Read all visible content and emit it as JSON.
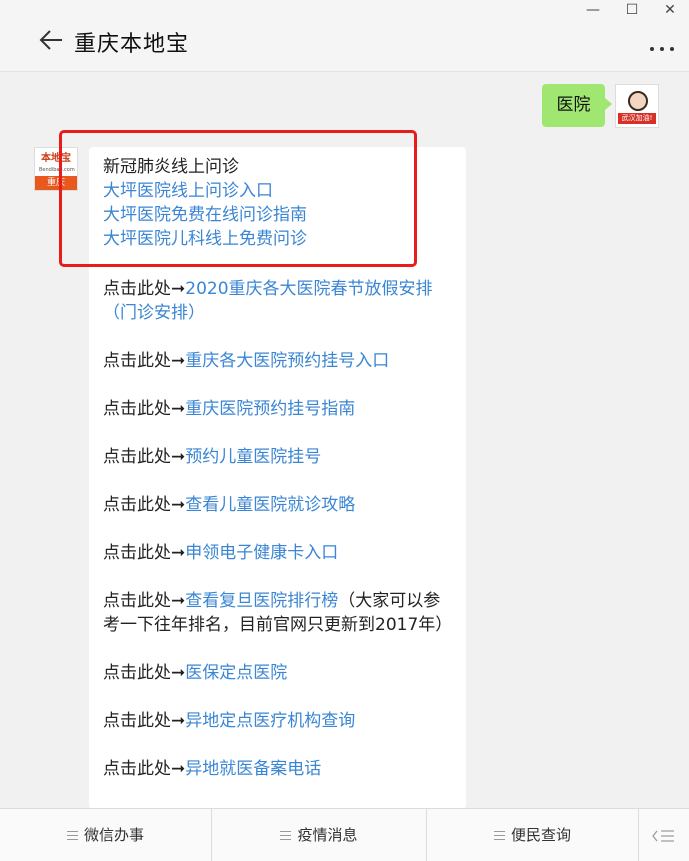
{
  "window": {
    "minimize": "—",
    "maximize": "☐",
    "close": "✕"
  },
  "header": {
    "title": "重庆本地宝"
  },
  "user_message": {
    "text": "医院",
    "avatar_tag": "武汉加油!"
  },
  "bot_avatar": {
    "top": "本地宝",
    "mid": "Bendibao.com",
    "bottom": "重庆"
  },
  "bot_message": {
    "heading": "新冠肺炎线上问诊",
    "links": [
      "大坪医院线上问诊入口",
      "大坪医院免费在线问诊指南",
      "大坪医院儿科线上免费问诊"
    ],
    "prefix": "点击此处➞",
    "items": [
      {
        "link": "2020重庆各大医院春节放假安排（门诊安排）",
        "suffix": ""
      },
      {
        "link": "重庆各大医院预约挂号入口",
        "suffix": ""
      },
      {
        "link": "重庆医院预约挂号指南",
        "suffix": ""
      },
      {
        "link": "预约儿童医院挂号",
        "suffix": ""
      },
      {
        "link": "查看儿童医院就诊攻略",
        "suffix": ""
      },
      {
        "link": "申领电子健康卡入口",
        "suffix": ""
      },
      {
        "link": "查看复旦医院排行榜",
        "suffix": "（大家可以参考一下往年排名，目前官网只更新到2017年）"
      },
      {
        "link": "医保定点医院",
        "suffix": ""
      },
      {
        "link": "异地定点医疗机构查询",
        "suffix": ""
      },
      {
        "link": "异地就医备案电话",
        "suffix": ""
      }
    ]
  },
  "bottom_menu": {
    "tab1": "微信办事",
    "tab2": "疫情消息",
    "tab3": "便民查询"
  },
  "colors": {
    "link": "#3a86d4",
    "user_bubble": "#9fe771",
    "highlight_box": "#ea1b1b"
  }
}
